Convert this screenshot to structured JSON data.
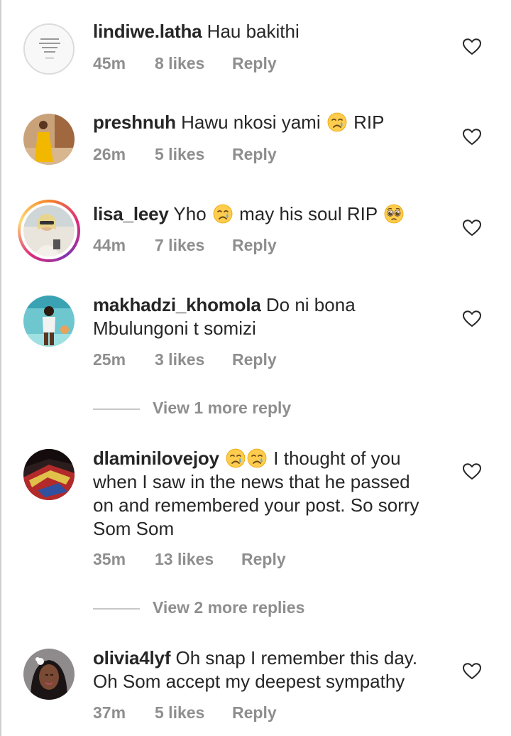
{
  "comments": [
    {
      "username": "lindiwe.latha",
      "text": "Hau bakithi",
      "time": "45m",
      "likes": "8 likes",
      "reply": "Reply",
      "avatar_text": "It's either a new week or a new week. You choose. -Ana Obrein"
    },
    {
      "username": "preshnuh",
      "text_before": "Hawu nkosi yami",
      "text_after": "RIP",
      "emoji": "crying-face",
      "time": "26m",
      "likes": "5 likes",
      "reply": "Reply"
    },
    {
      "username": "lisa_leey",
      "text_before": "Yho",
      "text_middle": "may his soul RIP",
      "emoji1": "crying-face",
      "emoji2": "pleading-face",
      "time": "44m",
      "likes": "7 likes",
      "reply": "Reply"
    },
    {
      "username": "makhadzi_khomola",
      "text_line1": "Do ni bona",
      "text_line2": "Mbulungoni t somizi",
      "time": "25m",
      "likes": "3 likes",
      "reply": "Reply",
      "view_more": "View 1 more reply"
    },
    {
      "username": "dlaminilovejoy",
      "text_line1": "I thought of you",
      "text_line2": "when I saw in the news that he passed",
      "text_line3": "on and remembered your post. So sorry",
      "text_line4": "Som Som",
      "emoji": "crying-face",
      "time": "35m",
      "likes": "13 likes",
      "reply": "Reply",
      "view_more": "View 2 more replies"
    },
    {
      "username": "olivia4lyf",
      "text_line1": "Oh snap I remember this day.",
      "text_line2": "Oh Som accept my deepest sympathy",
      "time": "37m",
      "likes": "5 likes",
      "reply": "Reply"
    }
  ],
  "icons": {
    "like": "heart-outline-icon",
    "emoji_cry": "crying-face",
    "emoji_plead": "pleading-face"
  },
  "colors": {
    "text": "#262626",
    "secondary": "#8e8e8e",
    "divider": "#c7c7c7"
  }
}
